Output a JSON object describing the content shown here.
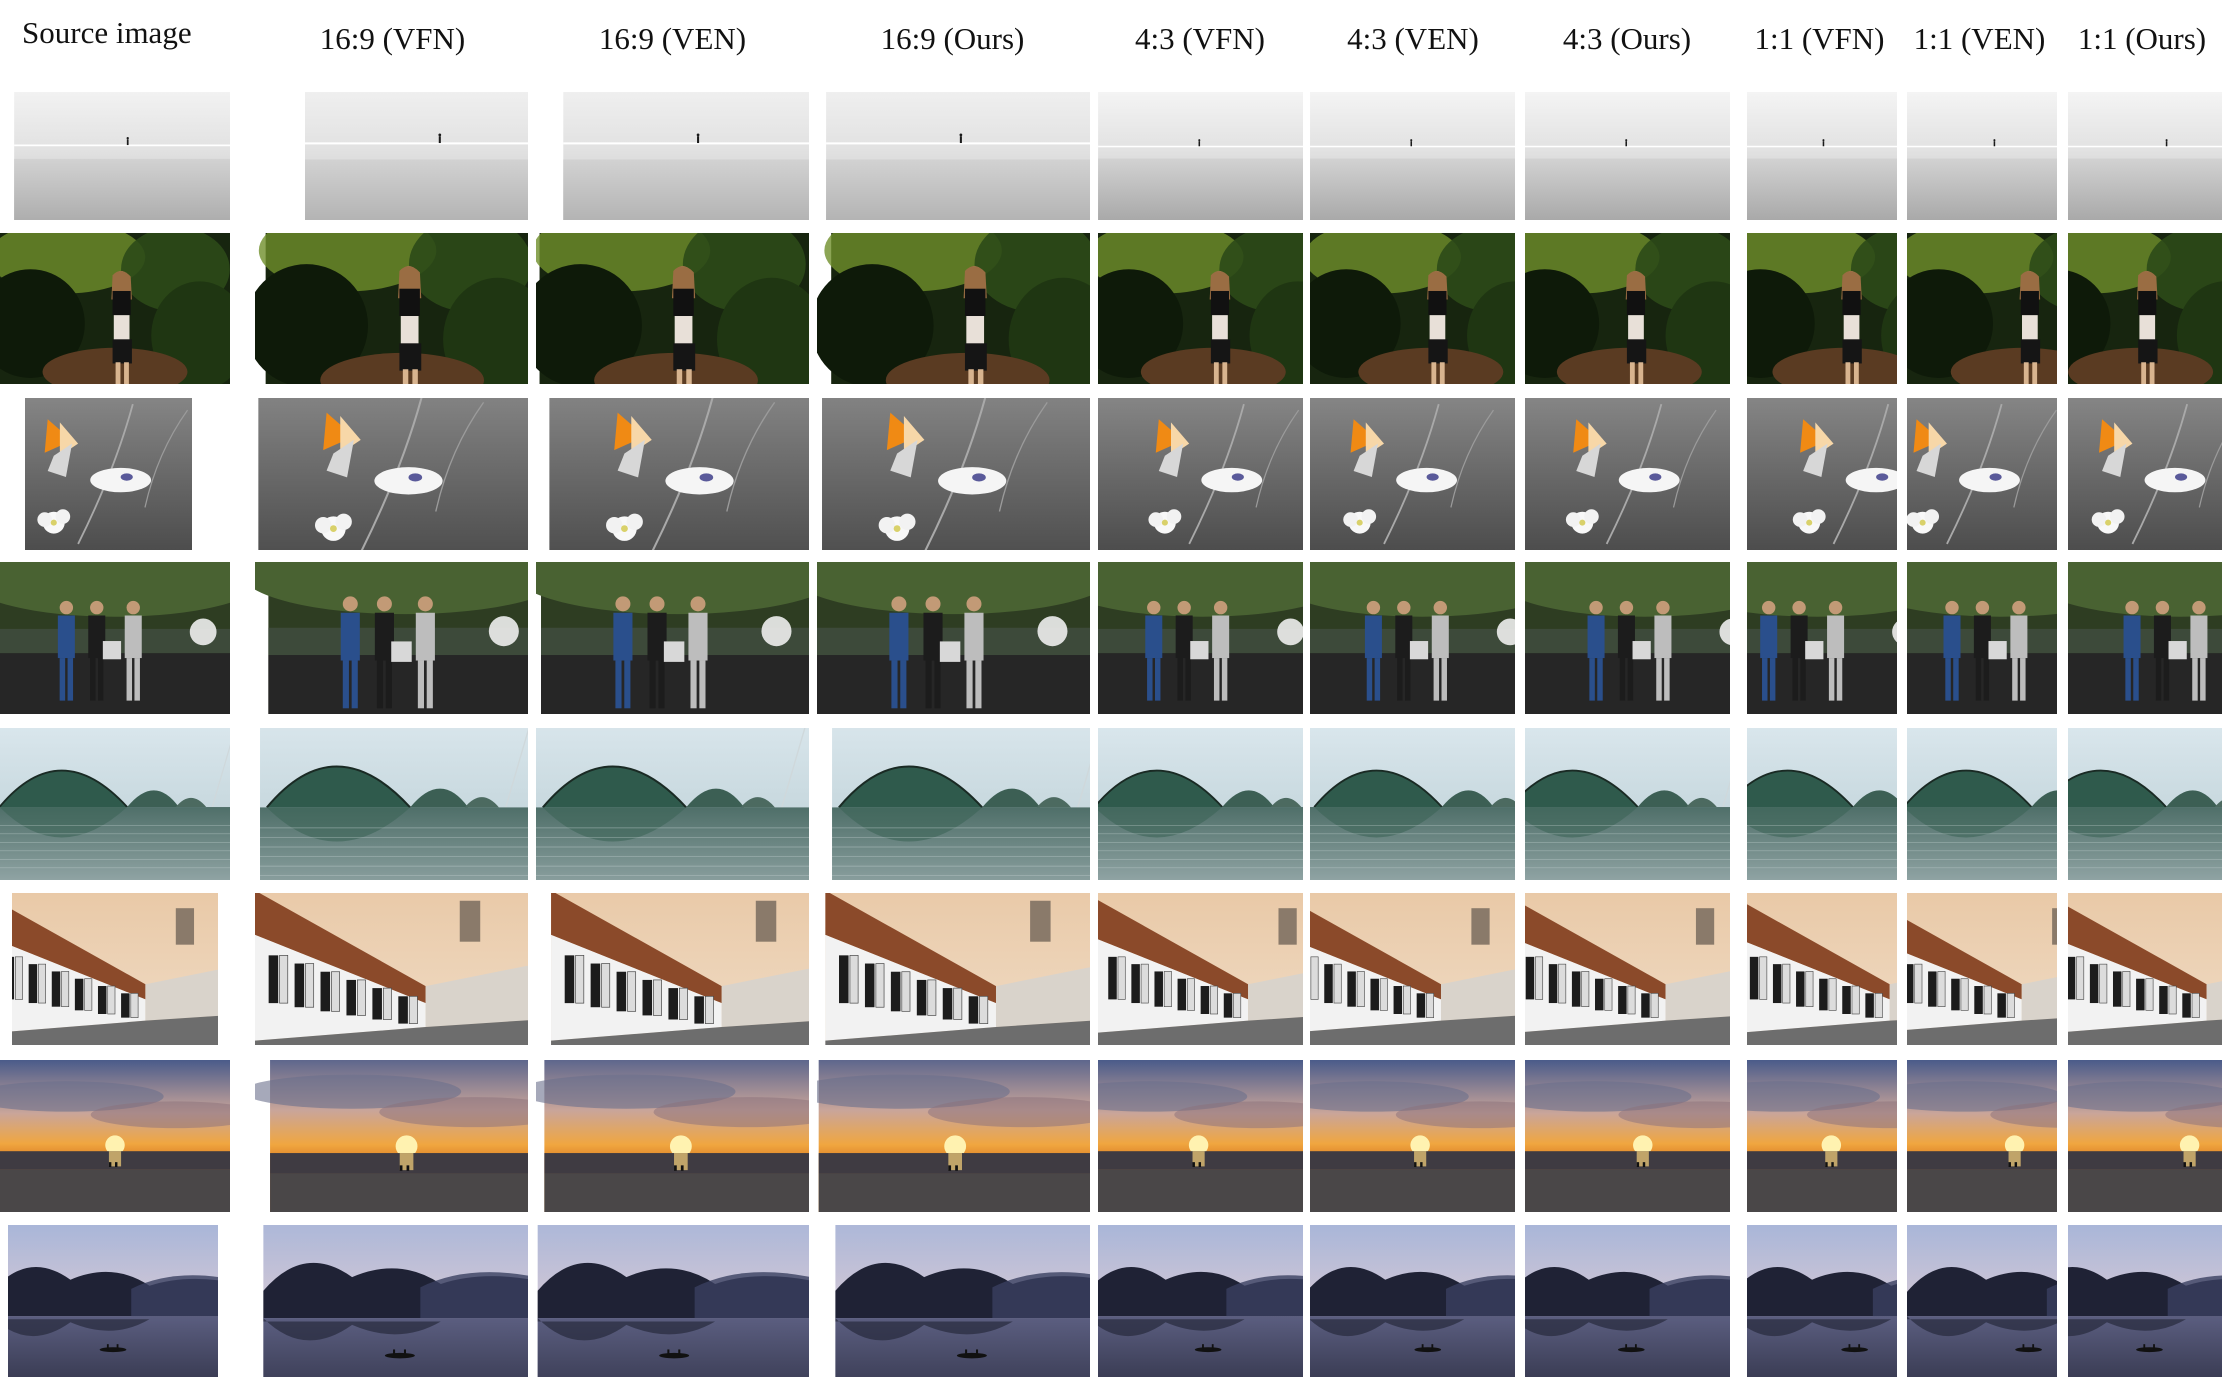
{
  "headers": {
    "source": "Source image",
    "c1": "16:9 (VFN)",
    "c2": "16:9 (VEN)",
    "c3": "16:9 (Ours)",
    "c4": "4:3 (VFN)",
    "c5": "4:3 (VEN)",
    "c6": "4:3 (Ours)",
    "c7": "1:1 (VFN)",
    "c8": "1:1 (VEN)",
    "c9": "1:1 (Ours)"
  },
  "rows": [
    {
      "scene": "misty-sea-lone-figure"
    },
    {
      "scene": "woman-in-forest"
    },
    {
      "scene": "butterfly-on-blossom"
    },
    {
      "scene": "three-women-walking"
    },
    {
      "scene": "dome-bridge-reflection"
    },
    {
      "scene": "white-houses-street"
    },
    {
      "scene": "sunset-over-sea"
    },
    {
      "scene": "lake-with-mountains-and-canoe"
    }
  ]
}
